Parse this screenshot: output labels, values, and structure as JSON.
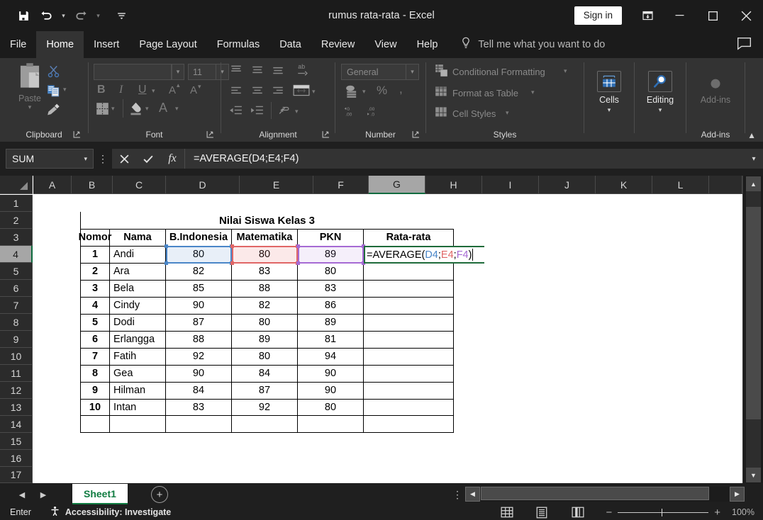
{
  "titlebar": {
    "quick_access": [
      {
        "name": "save-icon",
        "label": "Save"
      },
      {
        "name": "undo-icon",
        "label": "Undo"
      },
      {
        "name": "redo-icon",
        "label": "Redo"
      },
      {
        "name": "customize-qat-icon",
        "label": "Customize Quick Access Toolbar"
      }
    ],
    "document_title": "rumus rata-rata  -  Excel",
    "sign_in_label": "Sign in",
    "ribbon_display_icon": "ribbon-display-options-icon",
    "minimize_icon": "minimize-icon",
    "maximize_icon": "maximize-icon",
    "close_icon": "close-icon"
  },
  "tabs": [
    {
      "label": "File",
      "active": false
    },
    {
      "label": "Home",
      "active": true
    },
    {
      "label": "Insert",
      "active": false
    },
    {
      "label": "Page Layout",
      "active": false
    },
    {
      "label": "Formulas",
      "active": false
    },
    {
      "label": "Data",
      "active": false
    },
    {
      "label": "Review",
      "active": false
    },
    {
      "label": "View",
      "active": false
    },
    {
      "label": "Help",
      "active": false
    }
  ],
  "tell_me": {
    "icon": "lightbulb-icon",
    "placeholder": "Tell me what you want to do"
  },
  "comments_icon": "comment-icon",
  "ribbon": {
    "collapse_icon": "collapse-ribbon-icon",
    "groups": [
      {
        "label": "Clipboard",
        "has_dialog_launcher": true
      },
      {
        "label": "Font",
        "has_dialog_launcher": true
      },
      {
        "label": "Alignment",
        "has_dialog_launcher": true
      },
      {
        "label": "Number",
        "has_dialog_launcher": true
      },
      {
        "label": "Styles",
        "has_dialog_launcher": false
      },
      {
        "label": "Add-ins",
        "has_dialog_launcher": false
      }
    ],
    "clipboard": {
      "paste_label": "Paste",
      "cut_icon": "cut-scissors-icon",
      "copy_icon": "copy-icon",
      "format_painter_icon": "format-painter-icon"
    },
    "font": {
      "font_name_value": "",
      "font_size_value": "11",
      "bold_label": "B",
      "italic_label": "I",
      "underline_label": "U",
      "grow_font_label": "A",
      "shrink_font_label": "A",
      "borders_icon": "borders-icon",
      "fill_color_icon": "fill-color-icon",
      "font_color_label": "A"
    },
    "number": {
      "format_value": "General",
      "accounting_icon": "accounting-format-icon",
      "percent_label": "%",
      "comma_label": ",",
      "increase_decimal_label": ".00",
      "decrease_decimal_label": ".0"
    },
    "styles": {
      "conditional_formatting_label": "Conditional Formatting",
      "format_as_table_label": "Format as Table",
      "cell_styles_label": "Cell Styles"
    },
    "cells": {
      "label": "Cells",
      "icon": "cells-icon"
    },
    "editing": {
      "label": "Editing",
      "icon": "find-select-icon"
    },
    "addins": {
      "label": "Add-ins",
      "icon": "addins-icon"
    }
  },
  "formula_bar": {
    "name_box_value": "SUM",
    "cancel_icon": "cancel-x-icon",
    "enter_icon": "enter-check-icon",
    "insert_function_icon": "fx-icon",
    "formula_value": "=AVERAGE(D4;E4;F4)",
    "expand_icon": "expand-formula-bar-icon"
  },
  "grid": {
    "columns": [
      "A",
      "B",
      "C",
      "D",
      "E",
      "F",
      "G",
      "H",
      "I",
      "J",
      "K",
      "L"
    ],
    "selected_column": "G",
    "rows": [
      "1",
      "2",
      "3",
      "4",
      "5",
      "6",
      "7",
      "8",
      "9",
      "10",
      "11",
      "12",
      "13",
      "14",
      "15",
      "16",
      "17"
    ],
    "selected_row": "4",
    "active_cell": "G4"
  },
  "sheet": {
    "title": "Nilai Siswa Kelas 3",
    "headers": [
      "Nomor",
      "Nama",
      "B.Indonesia",
      "Matematika",
      "PKN",
      "Rata-rata"
    ],
    "rows": [
      {
        "nomor": "1",
        "nama": "Andi",
        "bindonesia": "80",
        "matematika": "80",
        "pkn": "89",
        "rata": ""
      },
      {
        "nomor": "2",
        "nama": "Ara",
        "bindonesia": "82",
        "matematika": "83",
        "pkn": "80",
        "rata": ""
      },
      {
        "nomor": "3",
        "nama": "Bela",
        "bindonesia": "85",
        "matematika": "88",
        "pkn": "83",
        "rata": ""
      },
      {
        "nomor": "4",
        "nama": "Cindy",
        "bindonesia": "90",
        "matematika": "82",
        "pkn": "86",
        "rata": ""
      },
      {
        "nomor": "5",
        "nama": "Dodi",
        "bindonesia": "87",
        "matematika": "80",
        "pkn": "89",
        "rata": ""
      },
      {
        "nomor": "6",
        "nama": "Erlangga",
        "bindonesia": "88",
        "matematika": "89",
        "pkn": "81",
        "rata": ""
      },
      {
        "nomor": "7",
        "nama": "Fatih",
        "bindonesia": "92",
        "matematika": "80",
        "pkn": "94",
        "rata": ""
      },
      {
        "nomor": "8",
        "nama": "Gea",
        "bindonesia": "90",
        "matematika": "84",
        "pkn": "90",
        "rata": ""
      },
      {
        "nomor": "9",
        "nama": "Hilman",
        "bindonesia": "84",
        "matematika": "87",
        "pkn": "90",
        "rata": ""
      },
      {
        "nomor": "10",
        "nama": "Intan",
        "bindonesia": "83",
        "matematika": "92",
        "pkn": "80",
        "rata": ""
      }
    ],
    "editing_cell": {
      "address": "G4",
      "text_prefix": "=AVERAGE(",
      "ref1": "D4",
      "sep1": ";",
      "ref2": "E4",
      "sep2": ";",
      "ref3": "F4",
      "text_suffix": ")"
    },
    "reference_colors": {
      "ref1": "#4a86c8",
      "ref2": "#e06666",
      "ref3": "#a66ad4",
      "active": "#1e6b3a"
    }
  },
  "sheet_tabs": {
    "prev_icon": "previous-sheet-icon",
    "next_icon": "next-sheet-icon",
    "tabs": [
      {
        "label": "Sheet1",
        "active": true
      }
    ],
    "add_sheet_icon": "add-sheet-icon",
    "options_icon": "sheet-options-kebab-icon",
    "hscroll_left_icon": "scroll-left-icon",
    "hscroll_right_icon": "scroll-right-icon"
  },
  "status_bar": {
    "mode": "Enter",
    "accessibility_icon": "accessibility-icon",
    "accessibility_label": "Accessibility: Investigate",
    "view_normal_icon": "normal-view-icon",
    "view_page_layout_icon": "page-layout-view-icon",
    "view_page_break_icon": "page-break-view-icon",
    "zoom_out_label": "−",
    "zoom_in_label": "+",
    "zoom_level": "100%"
  }
}
